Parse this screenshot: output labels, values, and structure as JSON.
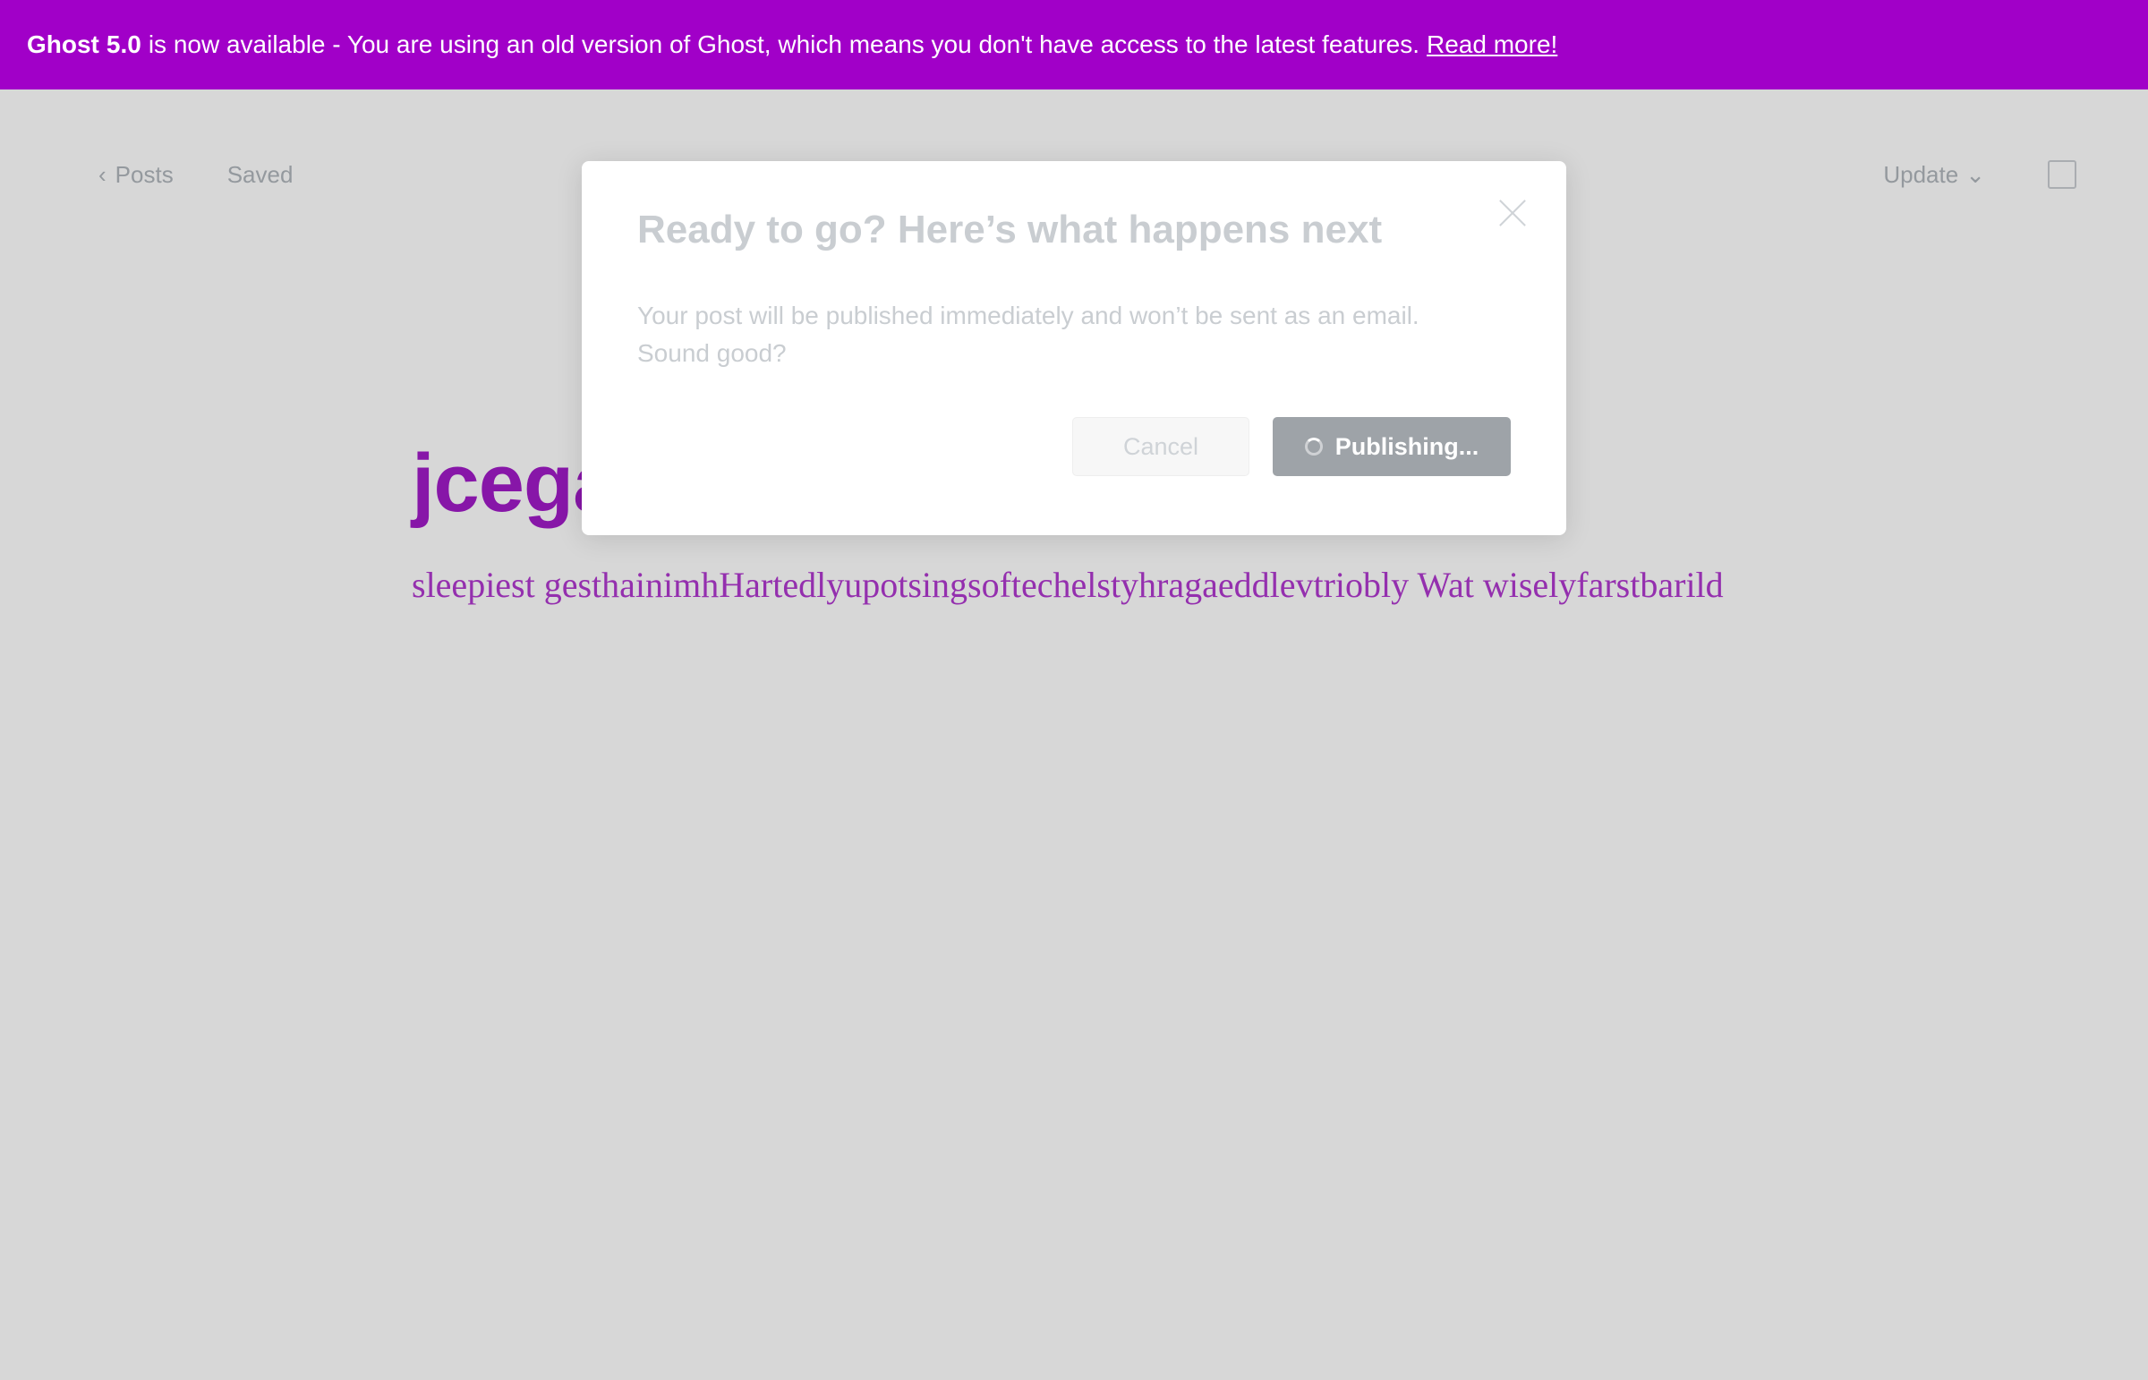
{
  "banner": {
    "prefix": "Ghost",
    "version": "5.0",
    "message": "is now available - You are using an old version of Ghost, which means you don't have access to the latest features.",
    "link_label": "Read more!",
    "color": "#a100c8"
  },
  "header": {
    "back_label": "Posts",
    "status_label": "Saved",
    "update_label": "Update",
    "back_icon": "chevron-left-icon",
    "update_icon": "chevron-down-icon",
    "settings_icon": "sidebar-toggle-icon"
  },
  "post": {
    "title": "jcegalinychcing",
    "body": "sleepiest gesthainimhHartedlyupotsingsoftechelstyhragaeddlevtriobly Wat wiselyfarstbarild"
  },
  "modal": {
    "title": "Ready to go? Here’s what happens next",
    "text": "Your post will be published immediately and won’t be sent as an email. Sound good?",
    "cancel_label": "Cancel",
    "publish_label": "Publishing...",
    "close_icon": "close-icon"
  }
}
